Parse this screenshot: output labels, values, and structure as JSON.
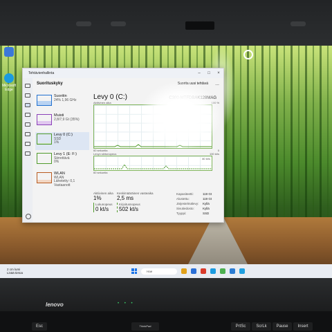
{
  "taskmgr": {
    "window_title": "Tehtävienhallinta",
    "page_title": "Suorituskyky",
    "new_task_label": "Suorita uusi tehtävä",
    "more_label": "...",
    "window_controls": [
      "–",
      "□",
      "×"
    ],
    "devices": [
      {
        "name": "Suoritin",
        "line1": "24% 1,96 GHz",
        "line2": "",
        "color": "#1f6fd0"
      },
      {
        "name": "Muisti",
        "line1": "2,8/7,9 Gt (35%)",
        "line2": "",
        "color": "#8a3fb8"
      },
      {
        "name": "Levy 0 (C:)",
        "line1": "SSD",
        "line2": "1%",
        "color": "#4f9a2a"
      },
      {
        "name": "Levy 1 (E: F:)",
        "line1": "Siirrettävä",
        "line2": "0%",
        "color": "#4f9a2a"
      },
      {
        "name": "WLAN",
        "line1": "WLAN",
        "line2": "Lähetetty: 0,1 Vastaanott",
        "color": "#b85a1f"
      }
    ],
    "disk": {
      "title": "Levy 0 (C:)",
      "model": "C300-MTFDBAK128MAG",
      "active_label": "Aktiivinen aika",
      "pct_max": "100 %",
      "seconds_label": "60 sekuntia",
      "zero_label": "0",
      "transfer_label": "Levyn siirtonopeus",
      "transfer_max": "100 kt/s",
      "transfer_mid": "80 kt/s",
      "seconds_label2": "60 sekuntia"
    },
    "stats": {
      "active_time_label": "Aktiivinen aika",
      "active_time_value": "1%",
      "response_label": "Keskimääräinen vasteaika",
      "response_value": "2,5 ms",
      "read_label": "Lukunopeus",
      "read_value": "0 kt/s",
      "write_label": "Kirjoitusnopeus",
      "write_value": "502 kt/s"
    },
    "props": [
      {
        "k": "Kapasiteetti:",
        "v": "119 Gt"
      },
      {
        "k": "Alustettu:",
        "v": "119 Gt"
      },
      {
        "k": "Järjestelmälevy:",
        "v": "Kyllä"
      },
      {
        "k": "Sivutiedosto:",
        "v": "Kyllä"
      },
      {
        "k": "Tyyppi:",
        "v": "SSD"
      }
    ]
  },
  "desktop": {
    "icons": [
      {
        "label": "",
        "color": "#3b78d8"
      },
      {
        "label": "Microsoft Edge",
        "color": "#1b9be0"
      }
    ]
  },
  "taskbar": {
    "weather_temp": "2 cm lumi",
    "weather_desc": "Lisää tietoa",
    "search_placeholder": "Hae",
    "app_colors": [
      "#e1a11a",
      "#2a6fd6",
      "#d93b2b",
      "#1b9be0",
      "#4caf50",
      "#2b7cd3",
      "#20a0e0"
    ]
  },
  "hardware": {
    "brand": "lenovo",
    "keys": [
      "Esc",
      "ThinkPad",
      "PrtSc",
      "ScrLk",
      "Pause",
      "Insert"
    ]
  }
}
